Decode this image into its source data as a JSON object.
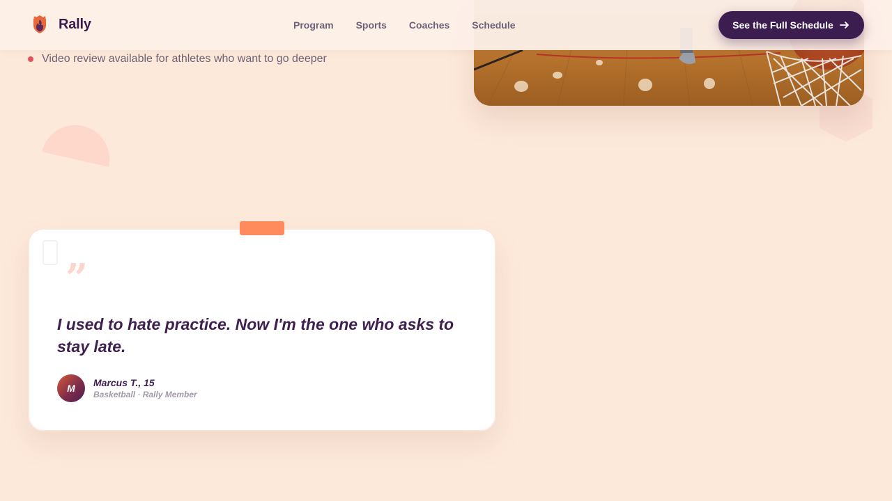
{
  "header": {
    "brand": "Rally",
    "nav": [
      "Program",
      "Sports",
      "Coaches",
      "Schedule"
    ],
    "cta_label": "See the Full Schedule"
  },
  "bullet": {
    "text": "Video review available for athletes who want to go deeper"
  },
  "testimonial": {
    "quote_mark": "”",
    "quote": "I used to hate practice. Now I'm the one who asks to stay late.",
    "avatar_initial": "M",
    "name": "Marcus T., 15",
    "meta": "Basketball · Rally Member"
  },
  "colors": {
    "background": "#fde9da",
    "brand_dark": "#3c1d4f",
    "accent_orange": "#ff8a5c",
    "bullet_red": "#e3525a"
  },
  "icons": {
    "logo": "flame-shield-icon",
    "cta": "arrow-right-icon"
  }
}
